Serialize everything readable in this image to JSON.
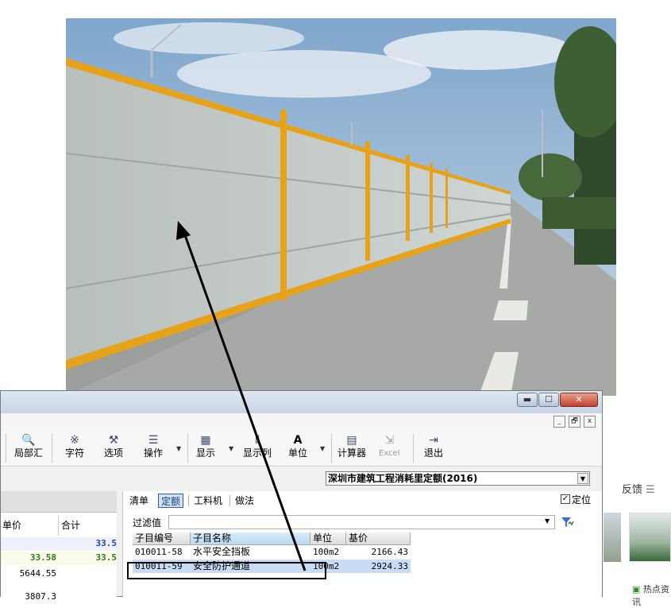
{
  "window": {
    "min_label": "▬",
    "max_label": "☐",
    "close_label": "✕"
  },
  "mdi": {
    "min_label": "_",
    "restore_label": "🗗",
    "close_label": "x"
  },
  "toolbar": {
    "items": [
      {
        "label": "局部汇",
        "icon": "zoom-sum-icon",
        "glyph": "🔍"
      },
      {
        "label": "字符",
        "icon": "asterisk-icon",
        "glyph": "※"
      },
      {
        "label": "选项",
        "icon": "hammer-icon",
        "glyph": "⚒"
      },
      {
        "label": "操作",
        "icon": "list-icon",
        "glyph": "☰"
      },
      {
        "label": "显示",
        "icon": "display-icon",
        "glyph": "▦"
      },
      {
        "label": "显示列",
        "icon": "columns-icon",
        "glyph": "⫴"
      },
      {
        "label": "单位",
        "icon": "font-a-icon",
        "glyph": "A"
      },
      {
        "label": "计算器",
        "icon": "calculator-icon",
        "glyph": "▤"
      },
      {
        "label": "Excel",
        "icon": "excel-export-icon",
        "glyph": "⇲"
      },
      {
        "label": "退出",
        "icon": "exit-door-icon",
        "glyph": "⇥"
      }
    ],
    "caret": "▼"
  },
  "quota_select": {
    "value": "深圳市建筑工程消耗里定额(2016)",
    "arrow": "▼"
  },
  "left_panel": {
    "col_unit_price": "单价",
    "col_total": "合计",
    "rows": [
      {
        "total": "33.5"
      },
      {
        "unit_price": "33.58",
        "total": "33.5"
      },
      {
        "unit_price": "5644.55"
      },
      {
        "unit_price": "3807.3"
      }
    ]
  },
  "tabs": [
    {
      "label": "清单"
    },
    {
      "label": "定额"
    },
    {
      "label": "工料机"
    },
    {
      "label": "做法"
    }
  ],
  "locate": {
    "label": "定位",
    "checked": "✓"
  },
  "filter": {
    "label": "过滤值",
    "value": "",
    "arrow": "▼"
  },
  "grid": {
    "headers": {
      "code": "子目编号",
      "name": "子目名称",
      "unit": "单位",
      "price": "基价"
    },
    "rows": [
      {
        "code": "010011-58",
        "name": "水平安全挡板",
        "unit": "100m2",
        "price": "2166.43"
      },
      {
        "code": "010011-59",
        "name": "安全防护通道",
        "unit": "100m2",
        "price": "2924.33"
      }
    ]
  },
  "right_strip": {
    "feedback": "反馈",
    "news": "热点资讯"
  },
  "colors": {
    "accent_blue": "#1a3f7a",
    "total_blue": "#1e3fd0",
    "green_value": "#2c7a1f",
    "selection": "#c9dcf5"
  }
}
